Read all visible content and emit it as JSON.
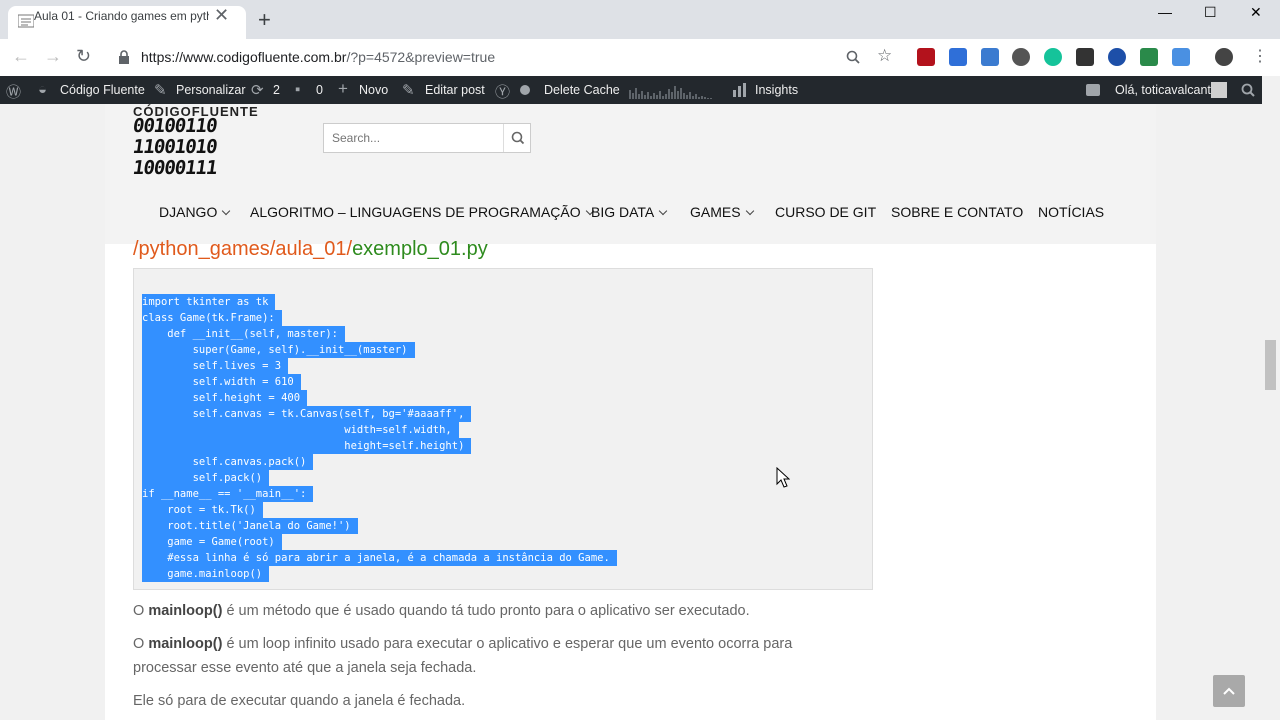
{
  "browser": {
    "tab_title": "Aula 01 - Criando games em pyth",
    "tab_close": "✕",
    "new_tab": "+",
    "window_minimize": "—",
    "window_maximize": "☐",
    "window_close": "✕",
    "url_main": "https://www.codigofluente.com.br",
    "url_rest": "/?p=4572&preview=true"
  },
  "adminbar": {
    "site_name": "Código Fluente",
    "customize": "Personalizar",
    "updates_count": "2",
    "comments_count": "0",
    "new": "Novo",
    "edit_post": "Editar post",
    "delete_cache": "Delete Cache",
    "insights": "Insights",
    "greeting": "Olá, toticavalcanti"
  },
  "header": {
    "logo_text": "CÓDIGOFLUENTE",
    "logo_lines": [
      "00100110",
      "11001010",
      "10000111"
    ],
    "search_placeholder": "Search...",
    "menu": [
      {
        "label": "DJANGO"
      },
      {
        "label": "ALGORITMO – LINGUAGENS DE PROGRAMAÇÃO"
      },
      {
        "label": "BIG DATA"
      },
      {
        "label": "GAMES"
      },
      {
        "label": "CURSO DE GIT"
      },
      {
        "label": "SOBRE E CONTATO"
      },
      {
        "label": "NOTÍCIAS"
      }
    ]
  },
  "content": {
    "path_dir": "/python_games/aula_01/",
    "path_file": "exemplo_01.py",
    "code_lines": [
      "import tkinter as tk",
      "class Game(tk.Frame):",
      "    def __init__(self, master):",
      "        super(Game, self).__init__(master)",
      "        self.lives = 3",
      "        self.width = 610",
      "        self.height = 400",
      "        self.canvas = tk.Canvas(self, bg='#aaaaff',",
      "                                width=self.width,",
      "                                height=self.height)",
      "        self.canvas.pack()",
      "        self.pack()",
      "if __name__ == '__main__':",
      "    root = tk.Tk()",
      "    root.title('Janela do Game!')",
      "    game = Game(root)",
      "    #essa linha é só para abrir a janela, é a chamada a instância do Game.",
      "    game.mainloop()"
    ],
    "p1_a": "O ",
    "p1_b": "mainloop()",
    "p1_c": " é um método que é usado quando tá tudo pronto para o aplicativo ser executado.",
    "p2_a": "O ",
    "p2_b": "mainloop()",
    "p2_c": " é um loop infinito usado para executar o aplicativo e esperar que um evento ocorra para",
    "p2_d": "processar esse evento até que a janela seja fechada.",
    "p3": "Ele só para de executar quando a janela é fechada."
  },
  "colors": {
    "path_dir": "#e05a1c",
    "path_file": "#2e8b1e",
    "selection": "#3390ff",
    "adminbar": "#23282d"
  }
}
